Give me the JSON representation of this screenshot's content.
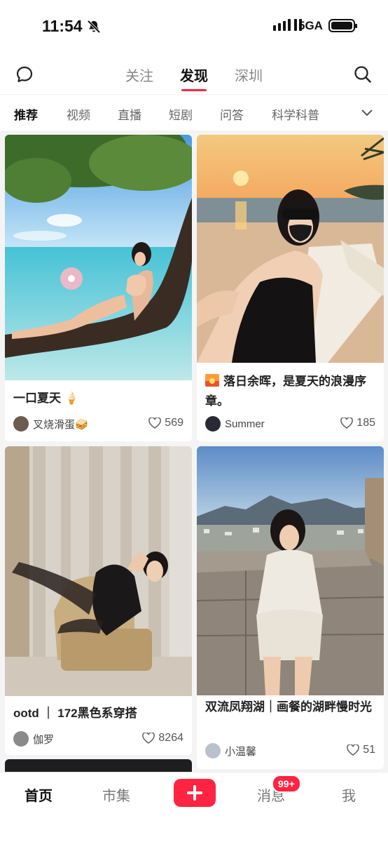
{
  "status_bar": {
    "time": "11:54",
    "network": "5GA"
  },
  "top_nav": {
    "tabs": [
      "关注",
      "发现",
      "深圳"
    ],
    "active_tab": "发现"
  },
  "channels": {
    "items": [
      "推荐",
      "视频",
      "直播",
      "短剧",
      "问答",
      "科学科普"
    ],
    "active": "推荐"
  },
  "feed": [
    {
      "title": "一口夏天 🍦",
      "author": "叉烧滑蛋🥪",
      "likes": "569"
    },
    {
      "title": "落日余晖，是夏天的浪漫序章。",
      "author": "Summer",
      "likes": "185"
    },
    {
      "title": "ootd ｜ 172黑色系穿搭",
      "author": "伽罗",
      "likes": "8264"
    },
    {
      "title": "双流凤翔湖｜画餐的湖畔慢时光",
      "author": "小温馨",
      "likes": "51"
    }
  ],
  "tab_bar": {
    "items": [
      "首页",
      "市集",
      "消息",
      "我"
    ],
    "active": "首页",
    "message_badge": "99+"
  },
  "colors": {
    "accent": "#ff2442",
    "background": "#f4f4f4"
  }
}
